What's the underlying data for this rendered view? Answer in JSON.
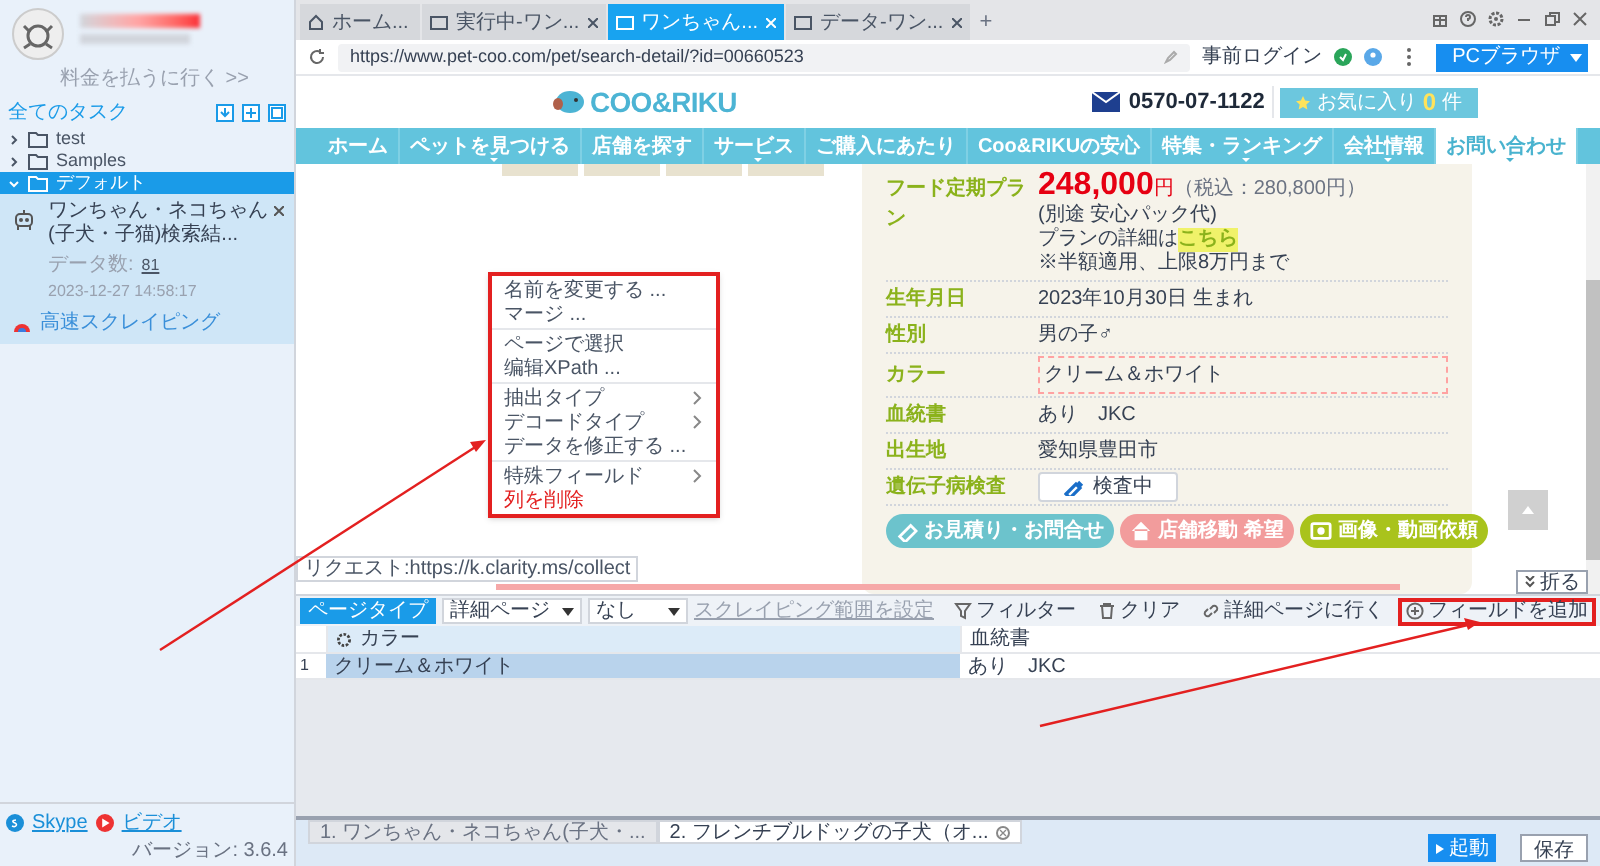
{
  "sidebar": {
    "billing_link": "料金を払うに行く >>",
    "section_title": "全てのタスク",
    "tree": [
      {
        "label": "test",
        "expanded": false,
        "selected": false
      },
      {
        "label": "Samples",
        "expanded": false,
        "selected": false
      },
      {
        "label": "デフォルト",
        "expanded": true,
        "selected": true,
        "tasks": [
          {
            "title": "ワンちゃん・ネコちゃん(子犬・子猫)検索結...",
            "data_count_label": "データ数:",
            "data_count": "81",
            "timestamp": "2023-12-27 14:58:17",
            "mode": "高速スクレイピング"
          }
        ]
      }
    ]
  },
  "sidebar_footer": {
    "links": [
      "Skype",
      "ビデオ"
    ],
    "version": "バージョン: 3.6.4"
  },
  "browser": {
    "tabs": [
      {
        "label": "ホーム...",
        "selected": false,
        "closable": false
      },
      {
        "label": "実行中-ワン...",
        "selected": false,
        "closable": true
      },
      {
        "label": "ワンちゃん...",
        "selected": true,
        "closable": true
      },
      {
        "label": "データ-ワン...",
        "selected": false,
        "closable": true
      }
    ],
    "new_tab": "+",
    "url": "https://www.pet-coo.com/pet/search-detail/?id=00660523",
    "pre_login": "事前ログイン",
    "mode_button": "PCブラウザ"
  },
  "web_page": {
    "logo": "COO&RIKU",
    "phone": "0570-07-1122",
    "favorites": {
      "label": "お気に入り",
      "count": "0",
      "unit": "件"
    },
    "nav": [
      {
        "label": "ホーム",
        "selected": false,
        "has_menu": false
      },
      {
        "label": "ペットを見つける",
        "selected": false,
        "has_menu": true
      },
      {
        "label": "店舗を探す",
        "selected": false,
        "has_menu": false
      },
      {
        "label": "サービス",
        "selected": false,
        "has_menu": true
      },
      {
        "label": "ご購入にあたり",
        "selected": false,
        "has_menu": false
      },
      {
        "label": "Coo&RIKUの安心",
        "selected": false,
        "has_menu": false
      },
      {
        "label": "特集・ランキング",
        "selected": false,
        "has_menu": true
      },
      {
        "label": "会社情報",
        "selected": false,
        "has_menu": true
      },
      {
        "label": "お問い合わせ",
        "selected": true,
        "has_menu": true
      }
    ],
    "plan": {
      "label": "フード定期プラン",
      "price": "248,000",
      "price_unit": "円",
      "tax_note": "（税込：280,800円）",
      "extra": "(別途 安心パック代)",
      "detail_text": "プランの詳細は",
      "detail_link": "こちら",
      "note": "※半額適用、上限8万円まで"
    },
    "details": [
      {
        "label": "生年月日",
        "value": "2023年10月30日 生まれ",
        "kind": "text"
      },
      {
        "label": "性別",
        "value": "男の子♂",
        "kind": "text"
      },
      {
        "label": "カラー",
        "value": "クリーム＆ホワイト",
        "kind": "highlighted"
      },
      {
        "label": "血統書",
        "value": "あり　JKC",
        "kind": "text"
      },
      {
        "label": "出生地",
        "value": "愛知県豊田市",
        "kind": "text"
      },
      {
        "label": "遺伝子病検査",
        "value": "検査中",
        "kind": "badge"
      }
    ],
    "actions": [
      {
        "label": "お見積り・お問合せ",
        "color": "#6cc3cc"
      },
      {
        "label": "店舗移動 希望",
        "color": "#f29c9c"
      },
      {
        "label": "画像・動画依頼",
        "color": "#a9c31c"
      }
    ]
  },
  "request_status": "リクエスト:https://k.clarity.ms/collect",
  "collapse_button": "折る",
  "context_menu": {
    "groups": [
      [
        {
          "label": "名前を変更する ...",
          "submenu": false,
          "kind": "normal"
        },
        {
          "label": "マージ ...",
          "submenu": false,
          "kind": "normal"
        }
      ],
      [
        {
          "label": "ページで選択",
          "submenu": false,
          "kind": "normal"
        },
        {
          "label": "编辑XPath ...",
          "submenu": false,
          "kind": "normal"
        }
      ],
      [
        {
          "label": "抽出タイプ",
          "submenu": true,
          "kind": "normal"
        },
        {
          "label": "デコードタイプ",
          "submenu": true,
          "kind": "normal"
        },
        {
          "label": "データを修正する ...",
          "submenu": false,
          "kind": "normal"
        }
      ],
      [
        {
          "label": "特殊フィールド",
          "submenu": true,
          "kind": "normal"
        },
        {
          "label": "列を削除",
          "submenu": false,
          "kind": "danger"
        }
      ]
    ]
  },
  "toolbar": {
    "page_type_label": "ページタイプ",
    "page_type_value": "詳細ページ",
    "second_select": "なし",
    "range_link": "スクレイピング範囲を設定",
    "actions": [
      {
        "label": "フィルター",
        "highlighted": false
      },
      {
        "label": "クリア",
        "highlighted": false
      },
      {
        "label": "詳細ページに行く",
        "highlighted": false
      },
      {
        "label": "フィールドを追加",
        "highlighted": true
      }
    ]
  },
  "table": {
    "columns": [
      {
        "label": "カラー",
        "selected": true
      },
      {
        "label": "血統書",
        "selected": false
      }
    ],
    "rows": [
      {
        "index": "1",
        "cells": [
          "クリーム＆ホワイト",
          "あり　JKC"
        ]
      }
    ]
  },
  "bottom_tabs": [
    {
      "label": "1. ワンちゃん・ネコちゃん(子犬・...",
      "selected": false,
      "closable": false
    },
    {
      "label": "2. フレンチブルドッグの子犬（オ...",
      "selected": true,
      "closable": true
    }
  ],
  "run_button": "起動",
  "save_button": "保存"
}
